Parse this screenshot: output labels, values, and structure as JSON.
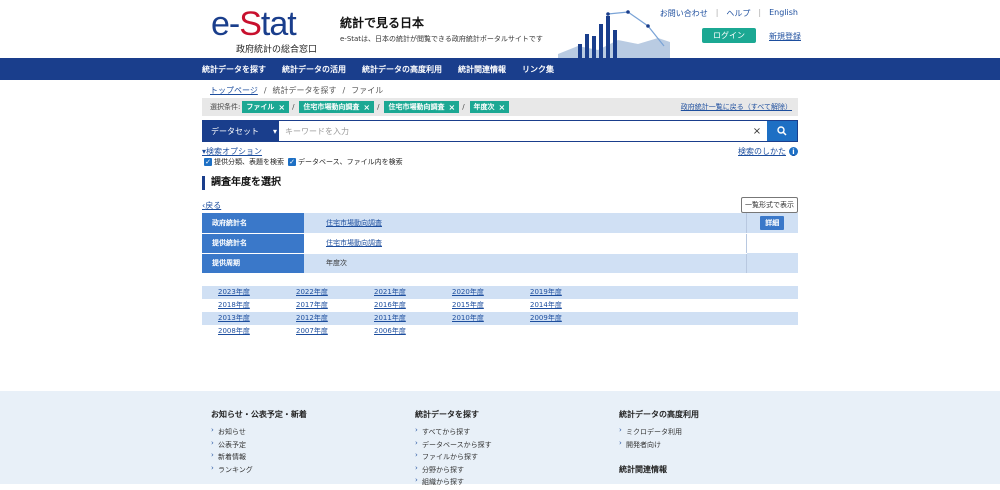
{
  "header": {
    "logo_text_e": "e-",
    "logo_text_s": "S",
    "logo_text_tat": "tat",
    "logo_sub": "政府統計の総合窓口",
    "site_title": "統計で見る日本",
    "site_desc": "e-Statは、日本の統計が閲覧できる政府統計ポータルサイトです",
    "links": [
      "お問い合わせ",
      "ヘルプ",
      "English"
    ],
    "link_sep": "|",
    "login": "ログイン",
    "register": "新規登録"
  },
  "nav": [
    "統計データを探す",
    "統計データの活用",
    "統計データの高度利用",
    "統計関連情報",
    "リンク集"
  ],
  "breadcrumb": {
    "home": "トップページ",
    "sep": "/",
    "level1": "統計データを探す",
    "level2": "ファイル"
  },
  "conditions": {
    "label": "選択条件:",
    "chips": [
      "ファイル",
      "住宅市場動向調査",
      "住宅市場動向調査",
      "年度次"
    ],
    "chip_close": "×",
    "sep": "/",
    "clear_link": "政府統計一覧に戻る（すべて解除）"
  },
  "search": {
    "select_label": "データセット",
    "select_caret": "▾",
    "placeholder": "キーワードを入力",
    "clear_icon": "×",
    "button_icon": "🔍"
  },
  "options": {
    "toggle": "検索オプション",
    "toggle_caret": "▾",
    "how_to": "検索のしかた",
    "info_icon": "i",
    "checks": [
      "提供分類、表題を検索",
      "データベース、ファイル内を検索"
    ],
    "check_mark": "✓"
  },
  "section_title": "調査年度を選択",
  "back": "戻る",
  "back_caret": "‹",
  "list_view": "一覧形式で表示",
  "info_table": [
    {
      "header": "政府統計名",
      "value": "住宅市場動向調査",
      "link": true,
      "action": "詳細"
    },
    {
      "header": "提供統計名",
      "value": "住宅市場動向調査",
      "link": true,
      "action": ""
    },
    {
      "header": "提供周期",
      "value": "年度次",
      "link": false,
      "action": ""
    }
  ],
  "years": [
    [
      "2023年度",
      "2022年度",
      "2021年度",
      "2020年度",
      "2019年度"
    ],
    [
      "2018年度",
      "2017年度",
      "2016年度",
      "2015年度",
      "2014年度"
    ],
    [
      "2013年度",
      "2012年度",
      "2011年度",
      "2010年度",
      "2009年度"
    ],
    [
      "2008年度",
      "2007年度",
      "2006年度"
    ]
  ],
  "footer": {
    "col1": {
      "title": "お知らせ・公表予定・新着",
      "items": [
        "お知らせ",
        "公表予定",
        "新着情報",
        "ランキング"
      ]
    },
    "col2": {
      "title": "統計データを探す",
      "items": [
        "すべてから探す",
        "データベースから探す",
        "ファイルから探す",
        "分野から探す",
        "組織から探す"
      ]
    },
    "col3": {
      "title": "統計データの高度利用",
      "items": [
        "ミクロデータ利用",
        "開発者向け"
      ]
    },
    "col3b": {
      "title": "統計関連情報"
    }
  },
  "colors": {
    "navy": "#1a3e8c",
    "teal": "#1ba893",
    "blue": "#3a78c9",
    "light_blue": "#d0e0f4",
    "red": "#c8102e"
  }
}
